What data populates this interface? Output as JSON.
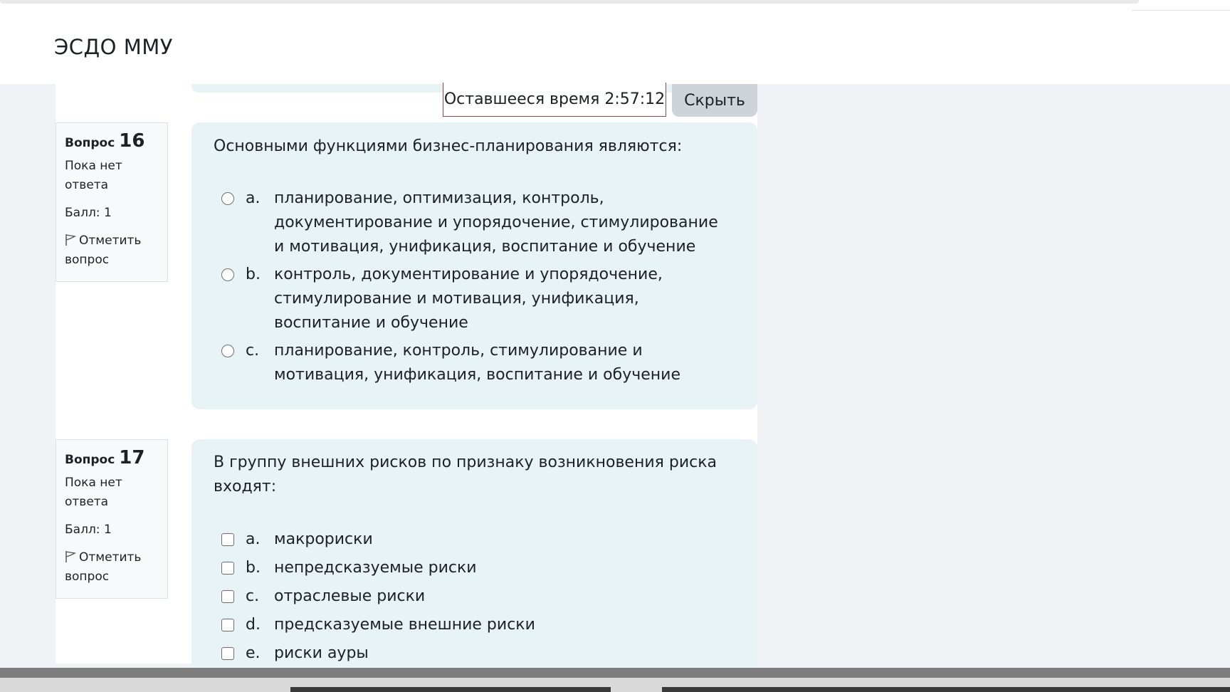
{
  "header": {
    "site_name": "ЭСДО ММУ"
  },
  "timer": {
    "label": "Оставшееся время",
    "value": "2:57:12"
  },
  "hide_button": {
    "label": "Скрыть"
  },
  "questions": [
    {
      "label": "Вопрос",
      "number": "16",
      "state": "Пока нет ответа",
      "mark": "Балл: 1",
      "flag_label": "Отметить вопрос",
      "text": "Основными функциями бизнес-планирования являются:",
      "control": "radio",
      "answers": [
        {
          "letter": "a.",
          "text": "планирование, оптимизация, контроль, документирование и упорядочение, стимулирование и мотивация, унификация, воспитание и обучение"
        },
        {
          "letter": "b.",
          "text": "контроль, документирование и упорядочение, стимулирование и мотивация, унификация, воспитание и обучение"
        },
        {
          "letter": "c.",
          "text": "планирование, контроль, стимулирование и мотивация, унификация, воспитание и обучение"
        }
      ]
    },
    {
      "label": "Вопрос",
      "number": "17",
      "state": "Пока нет ответа",
      "mark": "Балл: 1",
      "flag_label": "Отметить вопрос",
      "text": "В группу внешних рисков по признаку возникновения риска входят:",
      "control": "checkbox",
      "answers": [
        {
          "letter": "a.",
          "text": "макрориски"
        },
        {
          "letter": "b.",
          "text": "непредсказуемые риски"
        },
        {
          "letter": "c.",
          "text": "отраслевые риски"
        },
        {
          "letter": "d.",
          "text": "предсказуемые внешние риски"
        },
        {
          "letter": "e.",
          "text": "риски ауры"
        }
      ]
    }
  ]
}
